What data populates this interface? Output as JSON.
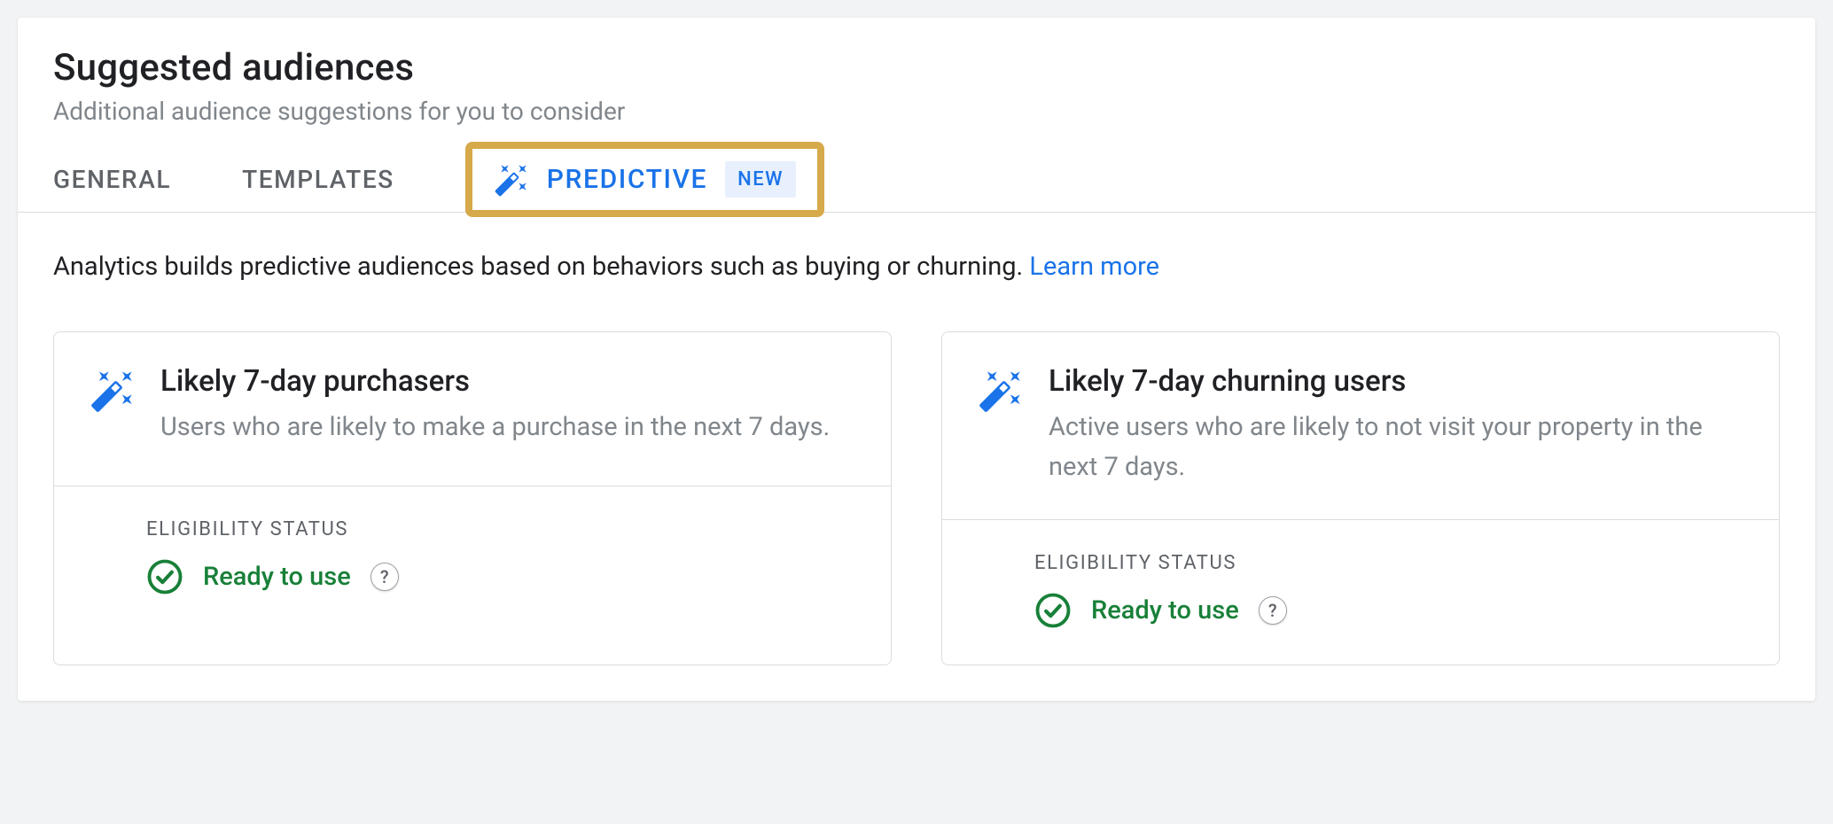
{
  "header": {
    "title": "Suggested audiences",
    "subtitle": "Additional audience suggestions for you to consider"
  },
  "tabs": {
    "general": "GENERAL",
    "templates": "TEMPLATES",
    "predictive": "PREDICTIVE",
    "badge_new": "NEW"
  },
  "intro": {
    "text": "Analytics builds predictive audiences based on behaviors such as buying or churning. ",
    "learn_more": "Learn more"
  },
  "cards": [
    {
      "title": "Likely 7-day purchasers",
      "description": "Users who are likely to make a purchase in the next 7 days.",
      "eligibility_label": "ELIGIBILITY STATUS",
      "status": "Ready to use"
    },
    {
      "title": "Likely 7-day churning users",
      "description": "Active users who are likely to not visit your property in the next 7 days.",
      "eligibility_label": "ELIGIBILITY STATUS",
      "status": "Ready to use"
    }
  ],
  "colors": {
    "primary": "#1a73e8",
    "success": "#188038",
    "highlight_border": "#d6a94a"
  }
}
